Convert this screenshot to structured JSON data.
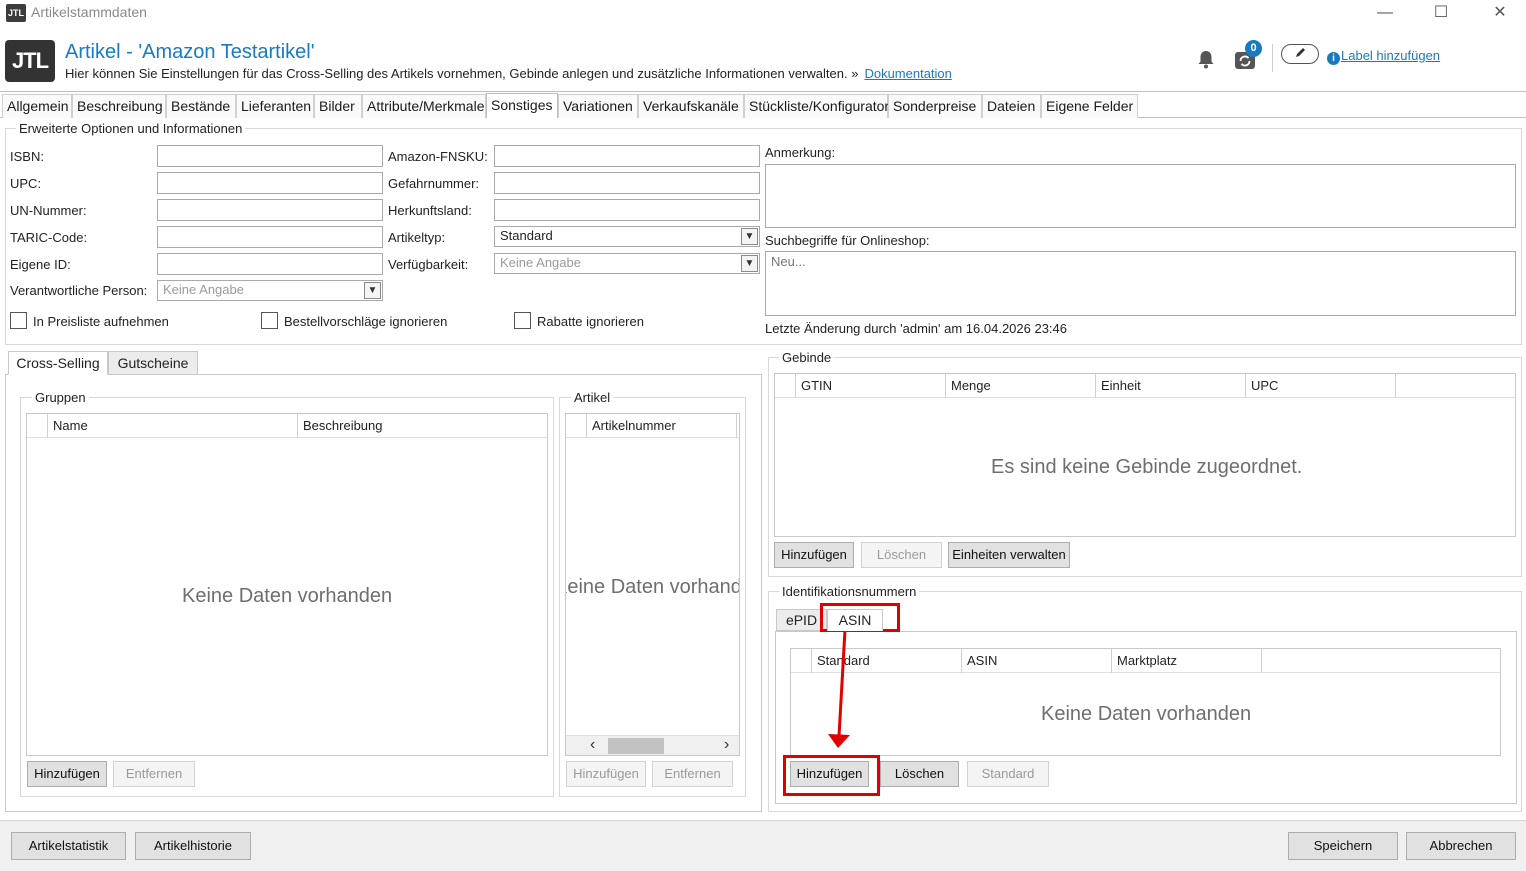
{
  "window": {
    "title": "Artikelstammdaten",
    "logo_small": "JTL",
    "minimize": "—",
    "maximize": "☐",
    "close": "✕"
  },
  "header": {
    "logo": "JTL",
    "title": "Artikel - 'Amazon Testartikel'",
    "subtitle": "Hier können Sie Einstellungen für das Cross-Selling des Artikels vornehmen, Gebinde anlegen und zusätzliche Informationen verwalten. »",
    "doc_link": "Dokumentation",
    "badge_count": "0",
    "label_link": "Label hinzufügen",
    "icons": [
      "bell-icon",
      "sync-icon",
      "pencil-icon",
      "info-icon"
    ]
  },
  "tabs": [
    "Allgemein",
    "Beschreibung",
    "Bestände",
    "Lieferanten",
    "Bilder",
    "Attribute/Merkmale",
    "Sonstiges",
    "Variationen",
    "Verkaufskanäle",
    "Stückliste/Konfigurator",
    "Sonderpreise",
    "Dateien",
    "Eigene Felder"
  ],
  "active_tab": "Sonstiges",
  "erweitert": {
    "legend": "Erweiterte Optionen und Informationen",
    "isbn": {
      "label": "ISBN:",
      "value": ""
    },
    "upc": {
      "label": "UPC:",
      "value": ""
    },
    "un": {
      "label": "UN-Nummer:",
      "value": ""
    },
    "taric": {
      "label": "TARIC-Code:",
      "value": ""
    },
    "eigene_id": {
      "label": "Eigene ID:",
      "value": ""
    },
    "verantwortliche": {
      "label": "Verantwortliche Person:",
      "value": "Keine Angabe"
    },
    "fnsku": {
      "label": "Amazon-FNSKU:",
      "value": ""
    },
    "gefahr": {
      "label": "Gefahrnummer:",
      "value": ""
    },
    "herkunft": {
      "label": "Herkunftsland:",
      "value": ""
    },
    "artikeltyp": {
      "label": "Artikeltyp:",
      "value": "Standard"
    },
    "verfuegbarkeit": {
      "label": "Verfügbarkeit:",
      "value": "Keine Angabe"
    },
    "chk_preisliste": "In Preisliste aufnehmen",
    "chk_bestell": "Bestellvorschläge ignorieren",
    "chk_rabatte": "Rabatte ignorieren",
    "anmerkung_label": "Anmerkung:",
    "anmerkung_value": "",
    "suchbegriffe_label": "Suchbegriffe für Onlineshop:",
    "suchbegriffe_placeholder": "Neu...",
    "letzte_aenderung": "Letzte Änderung durch 'admin' am 16.04.2026 23:46"
  },
  "left_tabs": [
    "Cross-Selling",
    "Gutscheine"
  ],
  "gruppen": {
    "legend": "Gruppen",
    "columns": [
      "Name",
      "Beschreibung"
    ],
    "empty": "Keine Daten vorhanden",
    "add": "Hinzufügen",
    "remove": "Entfernen"
  },
  "artikel": {
    "legend": "Artikel",
    "columns": [
      "Artikelnummer"
    ],
    "empty": "Keine Daten vorhanden",
    "add": "Hinzufügen",
    "remove": "Entfernen",
    "scroll_left": "‹",
    "scroll_right": "›"
  },
  "gebinde": {
    "legend": "Gebinde",
    "columns": [
      "GTIN",
      "Menge",
      "Einheit",
      "UPC"
    ],
    "empty": "Es sind keine Gebinde zugeordnet.",
    "add": "Hinzufügen",
    "delete": "Löschen",
    "units": "Einheiten verwalten"
  },
  "ident": {
    "legend": "Identifikationsnummern",
    "tabs": [
      "ePID",
      "ASIN"
    ],
    "active_tab": "ASIN",
    "columns": [
      "Standard",
      "ASIN",
      "Marktplatz"
    ],
    "empty": "Keine Daten vorhanden",
    "add": "Hinzufügen",
    "delete": "Löschen",
    "standard": "Standard"
  },
  "footer": {
    "stats": "Artikelstatistik",
    "history": "Artikelhistorie",
    "save": "Speichern",
    "cancel": "Abbrechen"
  },
  "colors": {
    "accent": "#1a7ac0",
    "highlight": "#e00000"
  }
}
